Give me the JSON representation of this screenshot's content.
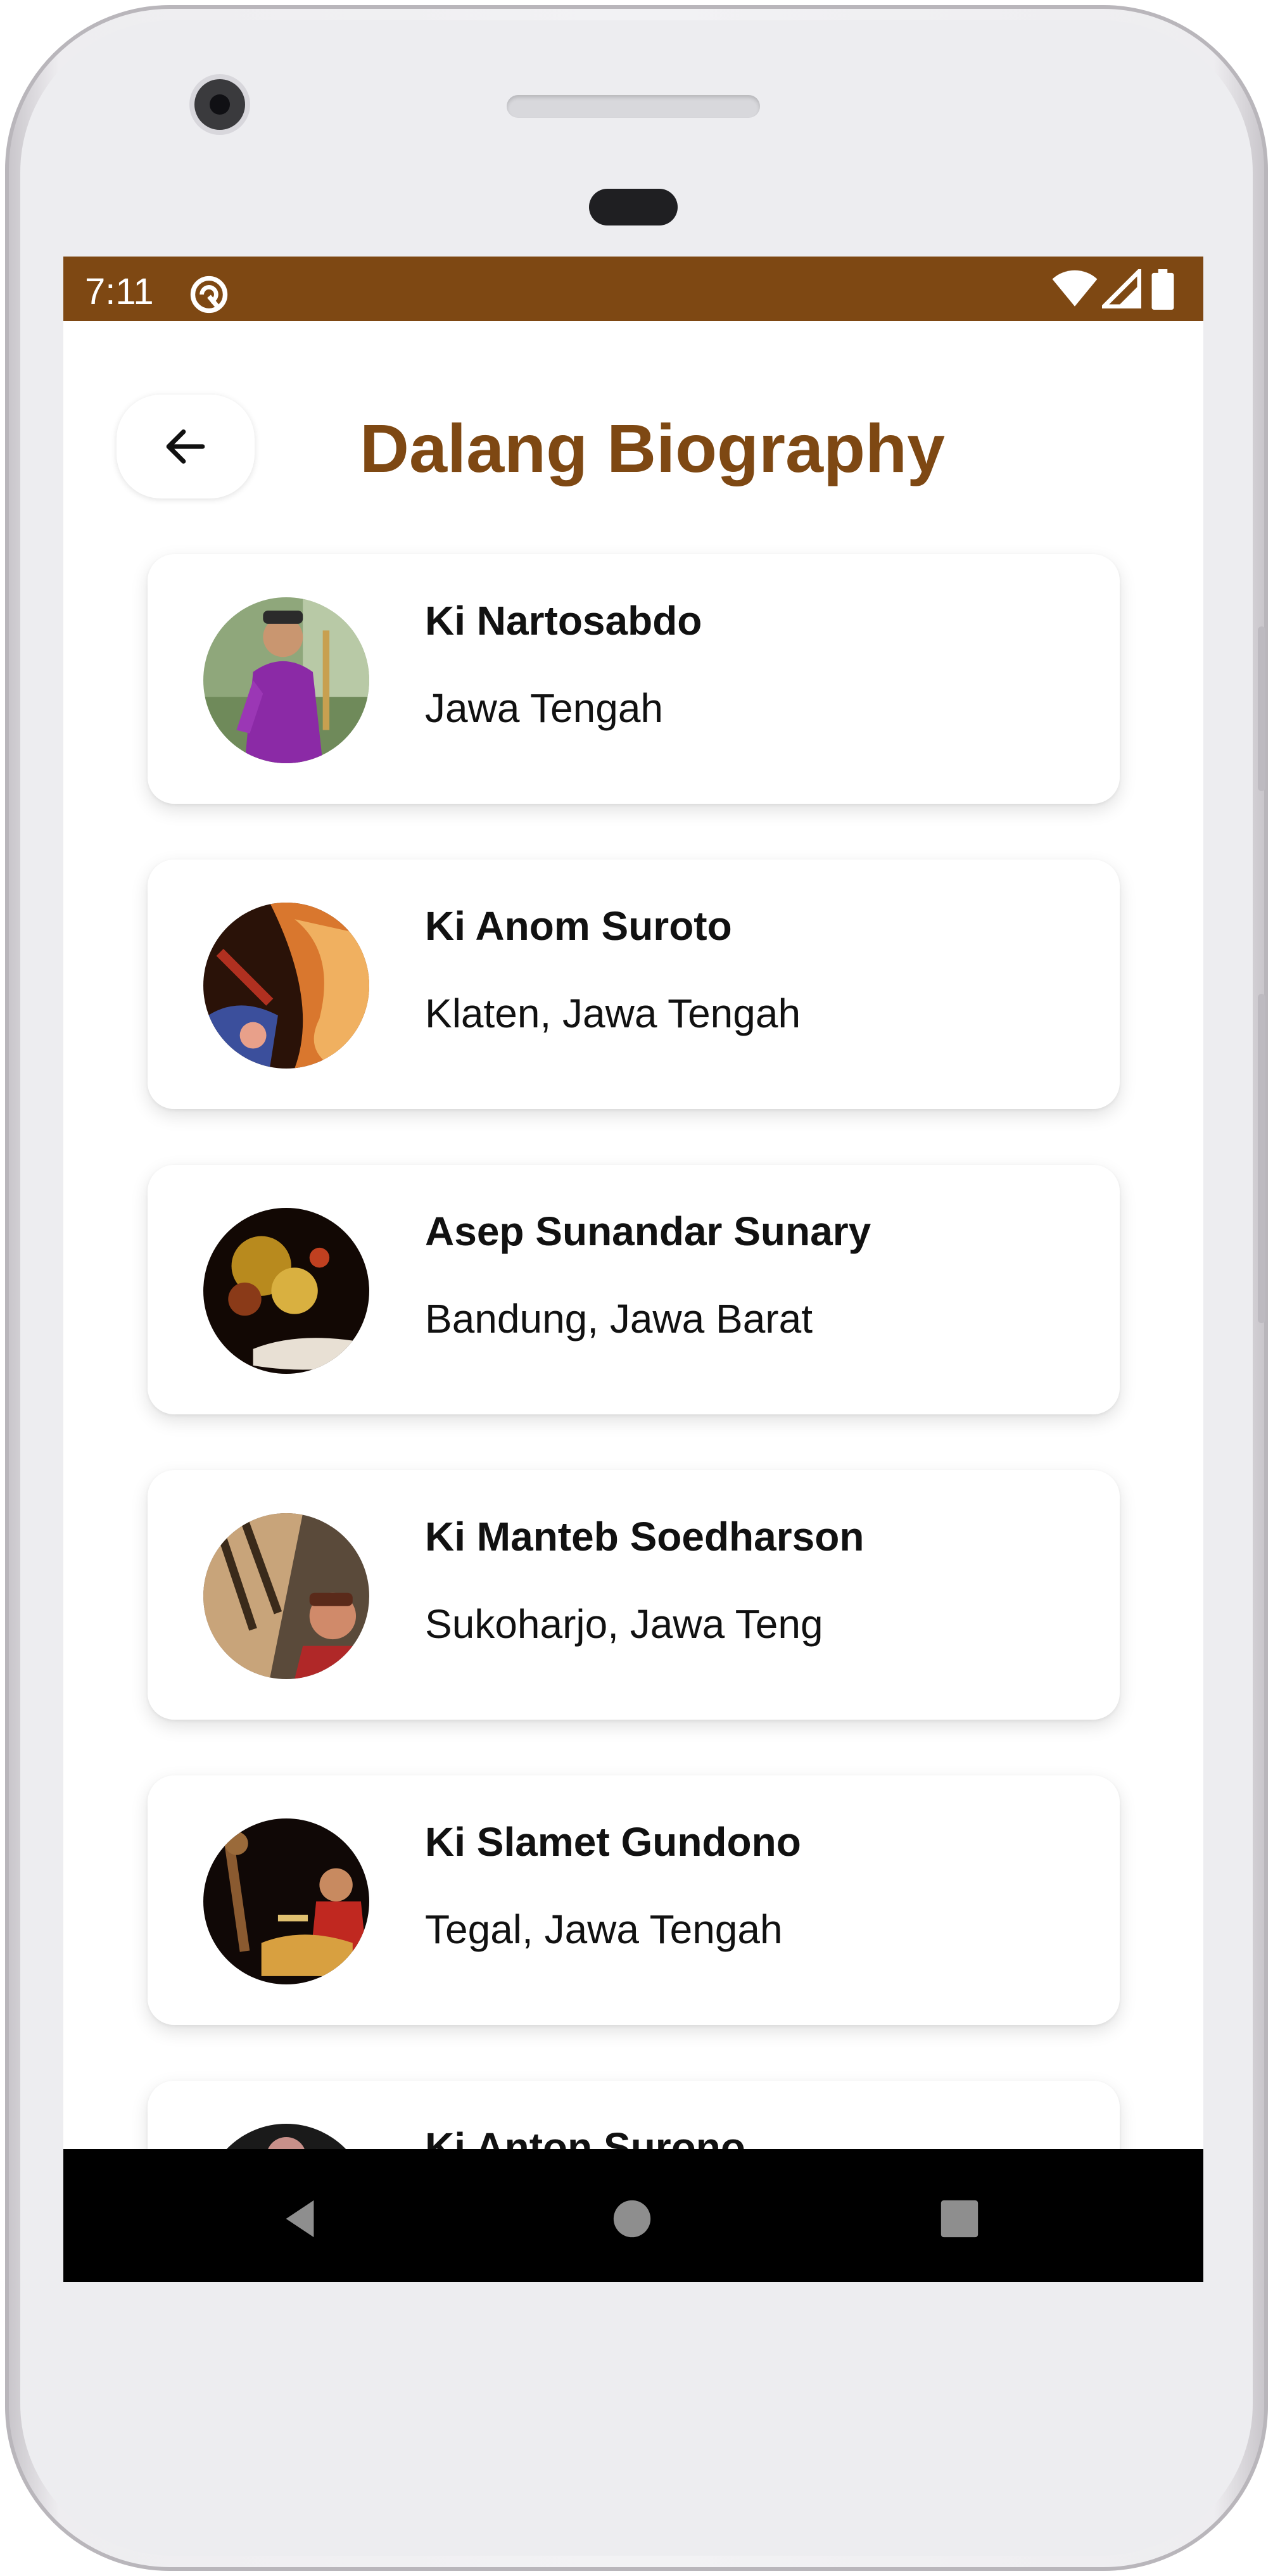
{
  "status_bar": {
    "time": "7:11",
    "color": "#7e4813",
    "icons": [
      "notification-icon",
      "wifi-icon",
      "signal-icon",
      "battery-icon"
    ]
  },
  "header": {
    "back_icon": "arrow-left-icon",
    "title": "Dalang Biography",
    "title_color": "#7e4813"
  },
  "dalang_list": [
    {
      "name": "Ki Nartosabdo",
      "location": "Jawa Tengah"
    },
    {
      "name": "Ki Anom Suroto",
      "location": "Klaten, Jawa Tengah"
    },
    {
      "name": "Asep Sunandar Sunary",
      "location": "Bandung, Jawa Barat"
    },
    {
      "name": "Ki Manteb Soedharson",
      "location": "Sukoharjo, Jawa Teng"
    },
    {
      "name": "Ki Slamet Gundono",
      "location": "Tegal, Jawa Tengah"
    },
    {
      "name": "Ki Anton Surono",
      "location": ""
    }
  ],
  "nav_bar": {
    "icons": [
      "back-triangle-icon",
      "home-circle-icon",
      "recents-square-icon"
    ]
  }
}
